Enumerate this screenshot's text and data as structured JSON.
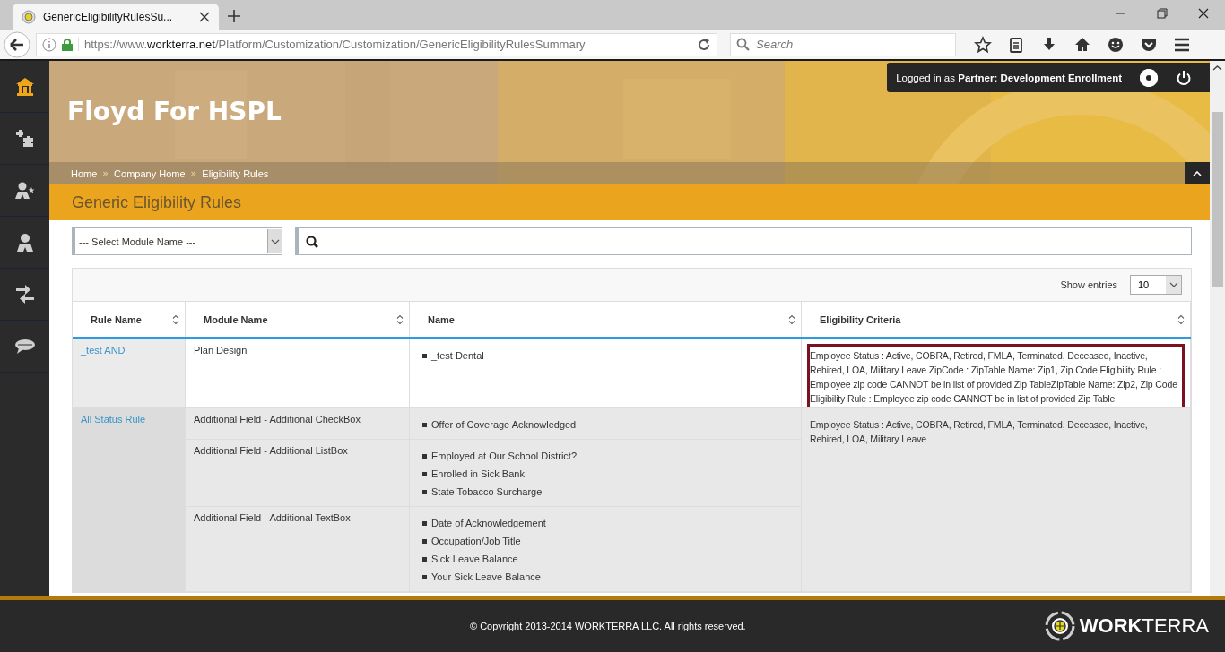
{
  "browser": {
    "tab_title": "GenericEligibilityRulesSu...",
    "url_prefix": "https://www.",
    "url_host": "workterra.net",
    "url_path": "/Platform/Customization/Customization/GenericEligibilityRulesSummary",
    "search_placeholder": "Search"
  },
  "sidebar": {
    "items": [
      {
        "kind": "home",
        "selected": true
      },
      {
        "kind": "puzzle",
        "selected": false
      },
      {
        "kind": "person-star",
        "selected": false
      },
      {
        "kind": "person",
        "selected": false
      },
      {
        "kind": "arrows",
        "selected": false
      },
      {
        "kind": "chat",
        "selected": false
      }
    ]
  },
  "user_panel": {
    "prefix": "Logged in as",
    "role": "Partner:",
    "name": "Development Enrollment"
  },
  "banner": {
    "title": "Floyd For HSPL"
  },
  "breadcrumbs": [
    {
      "kind": "link",
      "text": "Home"
    },
    {
      "kind": "separator",
      "text": "»"
    },
    {
      "kind": "link",
      "text": "Company Home"
    },
    {
      "kind": "separator",
      "text": "»"
    },
    {
      "kind": "link",
      "text": "Eligibility Rules"
    }
  ],
  "page_title": "Generic Eligibility Rules",
  "filters": {
    "module_select": "--- Select Module Name ---"
  },
  "table": {
    "show_entries_label": "Show entries",
    "page_size": "10",
    "columns": [
      "Rule Name",
      "Module Name",
      "Name",
      "Eligibility Criteria"
    ],
    "rules": [
      {
        "rule_name": "_test AND",
        "highlighted": true,
        "criteria": "Employee Status : Active, COBRA, Retired, FMLA, Terminated, Deceased, Inactive, Rehired, LOA, Military Leave ZipCode : ZipTable Name: Zip1, Zip Code Eligibility Rule : Employee zip code CANNOT be in list of provided Zip TableZipTable Name: Zip2, Zip Code Eligibility Rule : Employee zip code CANNOT be in list of provided Zip Table",
        "modules": [
          {
            "module": "Plan Design",
            "names": [
              "_test Dental"
            ]
          }
        ]
      },
      {
        "rule_name": "All Status Rule",
        "highlighted": false,
        "criteria": "Employee Status : Active, COBRA, Retired, FMLA, Terminated, Deceased, Inactive, Rehired, LOA, Military Leave",
        "modules": [
          {
            "module": "Additional Field - Additional CheckBox",
            "names": [
              "Offer of Coverage Acknowledged"
            ]
          },
          {
            "module": "Additional Field - Additional ListBox",
            "names": [
              "Employed at Our School District?",
              "Enrolled in Sick Bank",
              "State Tobacco Surcharge"
            ]
          },
          {
            "module": "Additional Field - Additional TextBox",
            "names": [
              "Date of Acknowledgement",
              "Occupation/Job Title",
              "Sick Leave Balance",
              "Your Sick Leave Balance"
            ]
          }
        ]
      }
    ]
  },
  "footer": {
    "copyright": "© Copyright 2013-2014 WORKTERRA LLC. All rights reserved.",
    "logo": "**WORK**TERRA"
  }
}
